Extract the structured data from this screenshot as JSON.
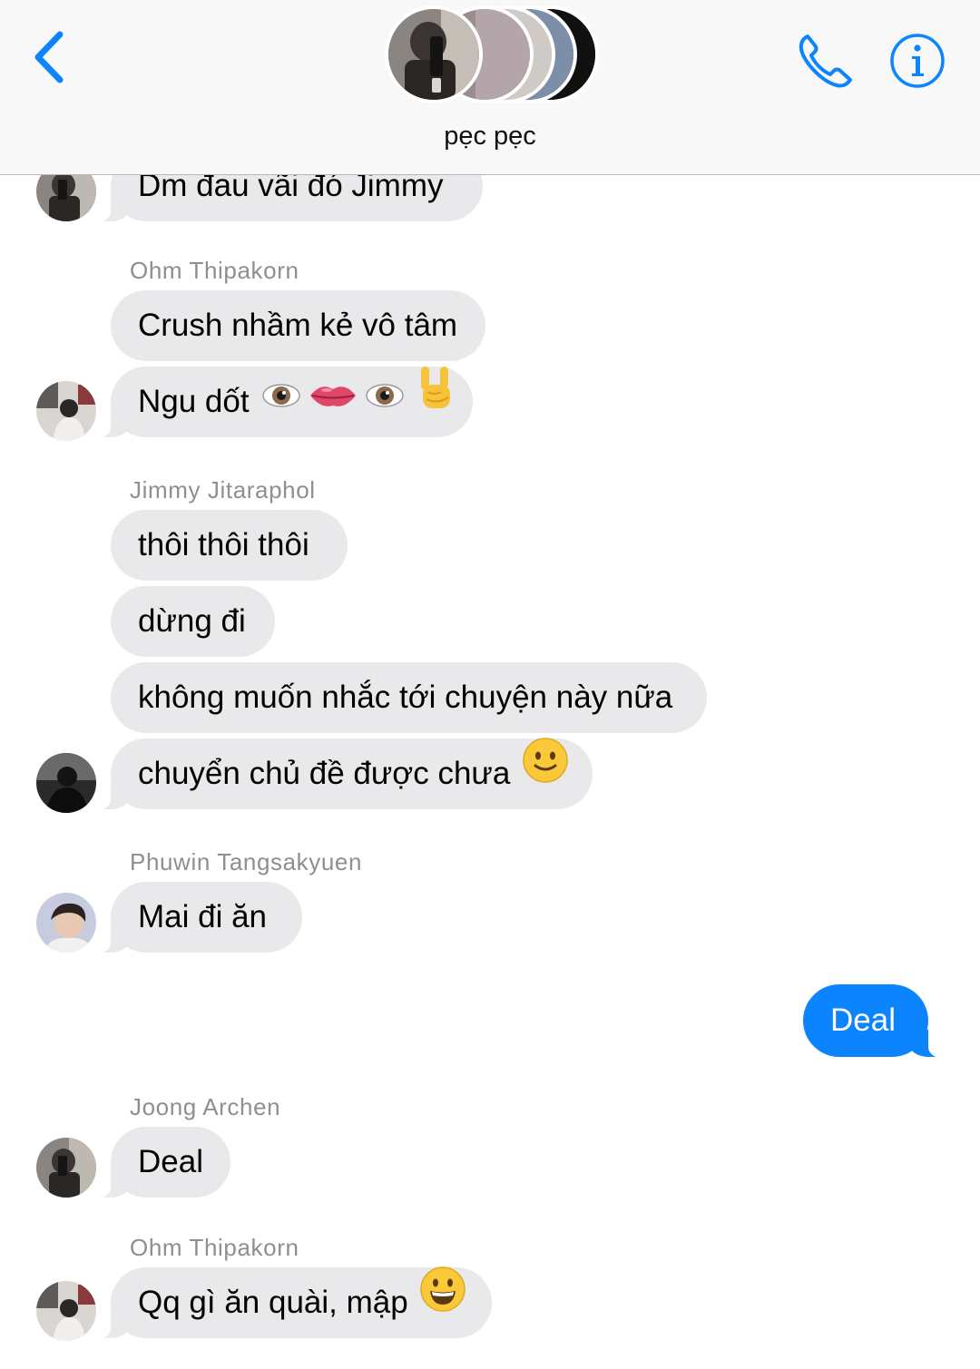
{
  "header": {
    "title": "pẹc pẹc",
    "back_icon": "chevron-left-icon",
    "call_icon": "phone-icon",
    "info_icon": "info-icon",
    "accent_color": "#0b84fe"
  },
  "messages": [
    {
      "text": "Dm đau vãi đó Jimmy"
    },
    {
      "sender": "Ohm Thipakorn",
      "text": "Crush nhầm kẻ vô tâm"
    },
    {
      "text": "Ngu dốt"
    },
    {
      "sender": "Jimmy Jitaraphol",
      "text": "thôi thôi thôi"
    },
    {
      "text": "dừng đi"
    },
    {
      "text": "không muốn nhắc tới chuyện này nữa"
    },
    {
      "text": "chuyển chủ đề được chưa"
    },
    {
      "sender": "Phuwin Tangsakyuen",
      "text": "Mai đi ăn"
    },
    {
      "text": "Deal",
      "outgoing": true
    },
    {
      "sender": "Joong Archen",
      "text": "Deal"
    },
    {
      "sender": "Ohm Thipakorn",
      "text": "Qq gì ăn quài, mập"
    }
  ],
  "colors": {
    "incoming_bubble": "#e9e9eb",
    "outgoing_bubble": "#0b84fe",
    "sender_name": "#8e8e93"
  }
}
